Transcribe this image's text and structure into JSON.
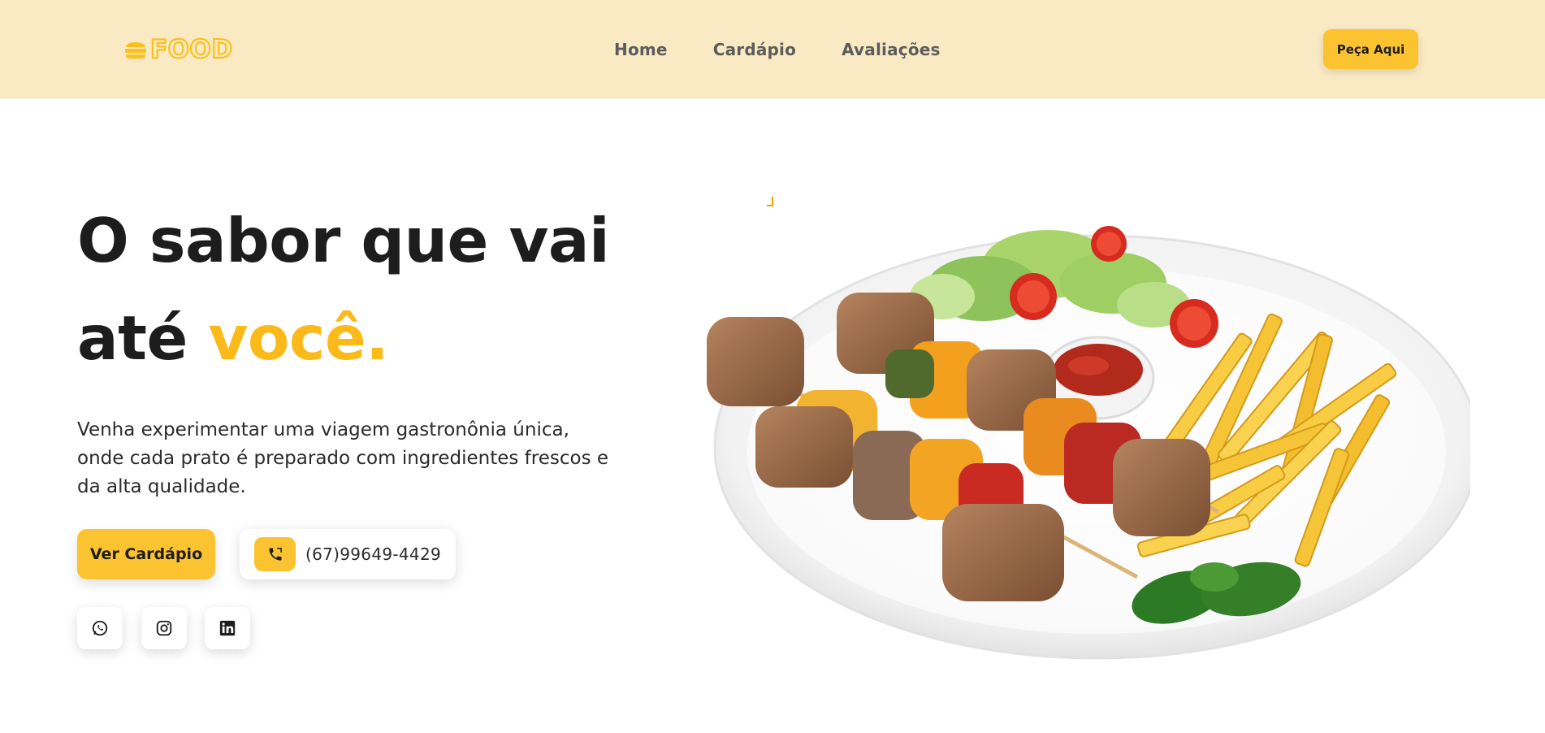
{
  "header": {
    "logo_text": "FOOD",
    "nav": [
      "Home",
      "Cardápio",
      "Avaliações"
    ],
    "order_button": "Peça Aqui"
  },
  "hero": {
    "title_line1": "O sabor que vai",
    "title_line2_start": "até",
    "title_line2_accent": "você.",
    "description": "Venha experimentar uma viagem gastronônia única, onde cada prato é preparado com ingredientes frescos e da alta qualidade.",
    "menu_button": "Ver Cardápio",
    "phone": "(67)99649-4429"
  },
  "social": {
    "icons": [
      "whatsapp-icon",
      "instagram-icon",
      "linkedin-icon"
    ]
  },
  "colors": {
    "header_bg": "#f9eac3",
    "accent": "#fcc331",
    "accent_text": "#fbb91a",
    "dark_text": "#1d1d1d"
  },
  "image": {
    "description": "plate with grilled meat skewers, fries, salad and sauce"
  }
}
